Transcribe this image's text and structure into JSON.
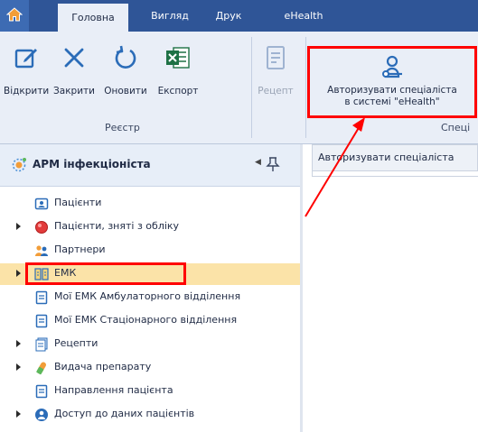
{
  "tabs": {
    "home_icon": "home-icon",
    "items": [
      {
        "label": "Головна"
      },
      {
        "label": "Вигляд"
      },
      {
        "label": "Друк"
      },
      {
        "label": "eHealth"
      }
    ]
  },
  "ribbon": {
    "registry_group": {
      "label": "Реєстр",
      "buttons": [
        {
          "label": "Відкрити",
          "icon": "edit-icon"
        },
        {
          "label": "Закрити",
          "icon": "close-icon"
        },
        {
          "label": "Оновити",
          "icon": "refresh-icon"
        },
        {
          "label": "Експорт",
          "icon": "excel-icon"
        }
      ]
    },
    "recipe_button": {
      "label": "Рецепт",
      "icon": "document-icon",
      "enabled": false
    },
    "authorize_button": {
      "line1": "Авторизувати спеціаліста",
      "line2": "в системі \"eHealth\"",
      "icon": "user-key-icon"
    },
    "specialist_group": {
      "label": "Спеці"
    }
  },
  "panel": {
    "title": "АРМ інфекціоніста",
    "items": [
      {
        "label": "Пацієнти",
        "icon": "patient-card-icon",
        "expandable": false
      },
      {
        "label": "Пацієнти, зняті з обліку",
        "icon": "red-dot-icon",
        "expandable": true
      },
      {
        "label": "Партнери",
        "icon": "partners-icon",
        "expandable": false
      },
      {
        "label": "ЕМК",
        "icon": "emk-icon",
        "expandable": true,
        "selected": true
      },
      {
        "label": "Мої ЕМК Амбулаторного відділення",
        "icon": "record-icon",
        "expandable": false
      },
      {
        "label": "Мої ЕМК Стаціонарного відділення",
        "icon": "record-icon",
        "expandable": false
      },
      {
        "label": "Рецепти",
        "icon": "recipes-icon",
        "expandable": true
      },
      {
        "label": "Видача препарату",
        "icon": "medicine-icon",
        "expandable": true
      },
      {
        "label": "Направлення пацієнта",
        "icon": "referral-icon",
        "expandable": false
      },
      {
        "label": "Доступ до даних пацієнтів",
        "icon": "access-icon",
        "expandable": true
      }
    ]
  },
  "grid": {
    "header": "Авторизувати спеціаліста"
  },
  "colors": {
    "tab_bar": "#2f5597",
    "ribbon": "#e9eef7",
    "highlight": "#ff0000",
    "selected_row": "#fbe3a8",
    "icon_blue": "#2b6cb8"
  }
}
